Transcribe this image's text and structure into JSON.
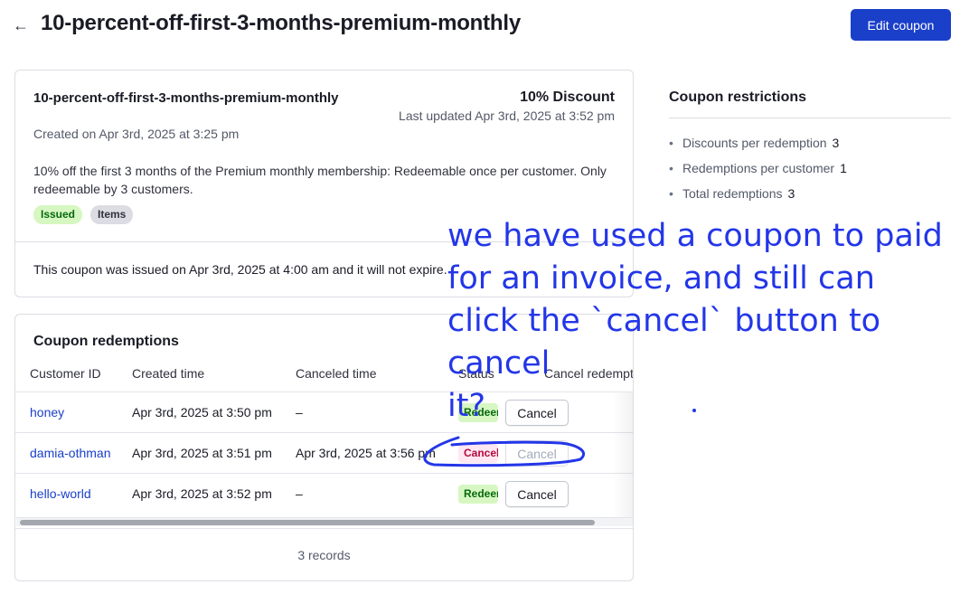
{
  "header": {
    "back_icon": "arrow-left-icon",
    "title": "10-percent-off-first-3-months-premium-monthly",
    "edit_button": "Edit coupon"
  },
  "coupon": {
    "name": "10-percent-off-first-3-months-premium-monthly",
    "created": "Created on Apr 3rd, 2025 at 3:25 pm",
    "discount": "10% Discount",
    "updated": "Last updated Apr 3rd, 2025 at 3:52 pm",
    "description": "10% off the first 3 months of the Premium monthly membership: Redeemable once per customer. Only redeemable by 3 customers.",
    "badges": [
      "Issued",
      "Items"
    ],
    "issued_note": "This coupon was issued on Apr 3rd, 2025 at 4:00 am and it will not expire."
  },
  "redemptions": {
    "title": "Coupon redemptions",
    "columns": [
      "Customer ID",
      "Created time",
      "Canceled time",
      "Status",
      "Cancel redemption"
    ],
    "rows": [
      {
        "customer": "honey",
        "created": "Apr 3rd, 2025 at 3:50 pm",
        "canceled": "–",
        "status": "Redeemed",
        "action": "Cancel"
      },
      {
        "customer": "damia-othman",
        "created": "Apr 3rd, 2025 at 3:51 pm",
        "canceled": "Apr 3rd, 2025 at 3:56 pm",
        "status": "Canceled",
        "action": "Cancel"
      },
      {
        "customer": "hello-world",
        "created": "Apr 3rd, 2025 at 3:52 pm",
        "canceled": "–",
        "status": "Redeemed",
        "action": "Cancel"
      }
    ],
    "records": "3 records"
  },
  "restrictions": {
    "title": "Coupon restrictions",
    "items": [
      {
        "label": "Discounts per redemption",
        "value": "3"
      },
      {
        "label": "Redemptions per customer",
        "value": "1"
      },
      {
        "label": "Total redemptions",
        "value": "3"
      }
    ]
  },
  "annotation": {
    "text": "we have used a coupon to paid\nfor an invoice, and still can\nclick the `cancel` button to cancel\nit?"
  },
  "colors": {
    "primary": "#1a3fc9",
    "annotation_ink": "#2336e8",
    "status_redeemed": "#d7f7c2",
    "status_canceled": "#ffe7f2"
  }
}
